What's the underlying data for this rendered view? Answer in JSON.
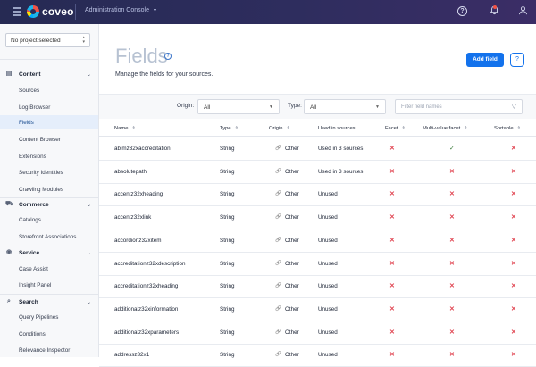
{
  "header": {
    "logo_text": "coveo",
    "console_label": "Administration Console",
    "help_glyph": "?",
    "bell_glyph": "🔔",
    "user_glyph": "👤"
  },
  "sidebar": {
    "project_select": "No project selected",
    "sections": [
      {
        "label": "Content",
        "icon": "content-icon",
        "items": [
          "Sources",
          "Log Browser",
          "Fields",
          "Content Browser",
          "Extensions",
          "Security Identities",
          "Crawling Modules"
        ]
      },
      {
        "label": "Commerce",
        "icon": "cart-icon",
        "items": [
          "Catalogs",
          "Storefront Associations"
        ]
      },
      {
        "label": "Service",
        "icon": "service-icon",
        "items": [
          "Case Assist",
          "Insight Panel"
        ]
      },
      {
        "label": "Search",
        "icon": "search-icon",
        "items": [
          "Query Pipelines",
          "Conditions",
          "Relevance Inspector"
        ]
      }
    ],
    "active_item": "Fields"
  },
  "page": {
    "title": "Fields",
    "info_glyph": "?",
    "subtitle": "Manage the fields for your sources.",
    "add_button": "Add field",
    "circle_glyph": "?"
  },
  "filters": {
    "origin_label": "Origin:",
    "origin_value": "All",
    "type_label": "Type:",
    "type_value": "All",
    "search_placeholder": "Filter field names"
  },
  "table": {
    "columns": [
      "Name",
      "Type",
      "Origin",
      "Used in sources",
      "Facet",
      "Multi-value facet",
      "Sortable"
    ],
    "rows": [
      {
        "name": "abimz32xaccreditation",
        "type": "String",
        "origin": "Other",
        "used": "Used in 3 sources",
        "facet": "✕",
        "multi": "✓",
        "sortable": "✕"
      },
      {
        "name": "absolutepath",
        "type": "String",
        "origin": "Other",
        "used": "Used in 3 sources",
        "facet": "✕",
        "multi": "✕",
        "sortable": "✕"
      },
      {
        "name": "accentz32xheading",
        "type": "String",
        "origin": "Other",
        "used": "Unused",
        "facet": "✕",
        "multi": "✕",
        "sortable": "✕"
      },
      {
        "name": "accentz32xlink",
        "type": "String",
        "origin": "Other",
        "used": "Unused",
        "facet": "✕",
        "multi": "✕",
        "sortable": "✕"
      },
      {
        "name": "accordionz32xitem",
        "type": "String",
        "origin": "Other",
        "used": "Unused",
        "facet": "✕",
        "multi": "✕",
        "sortable": "✕"
      },
      {
        "name": "accreditationz32xdescription",
        "type": "String",
        "origin": "Other",
        "used": "Unused",
        "facet": "✕",
        "multi": "✕",
        "sortable": "✕"
      },
      {
        "name": "accreditationz32xheading",
        "type": "String",
        "origin": "Other",
        "used": "Unused",
        "facet": "✕",
        "multi": "✕",
        "sortable": "✕"
      },
      {
        "name": "additionalz32xinformation",
        "type": "String",
        "origin": "Other",
        "used": "Unused",
        "facet": "✕",
        "multi": "✕",
        "sortable": "✕"
      },
      {
        "name": "additionalz32xparameters",
        "type": "String",
        "origin": "Other",
        "used": "Unused",
        "facet": "✕",
        "multi": "✕",
        "sortable": "✕"
      },
      {
        "name": "addressz32x1",
        "type": "String",
        "origin": "Other",
        "used": "Unused",
        "facet": "✕",
        "multi": "✕",
        "sortable": "✕"
      }
    ]
  },
  "colors": {
    "topbar": "#262a53",
    "accent": "#1372ec",
    "active_bg": "#e5eefb",
    "cross": "#e0424f",
    "check": "#3c7c3c"
  }
}
